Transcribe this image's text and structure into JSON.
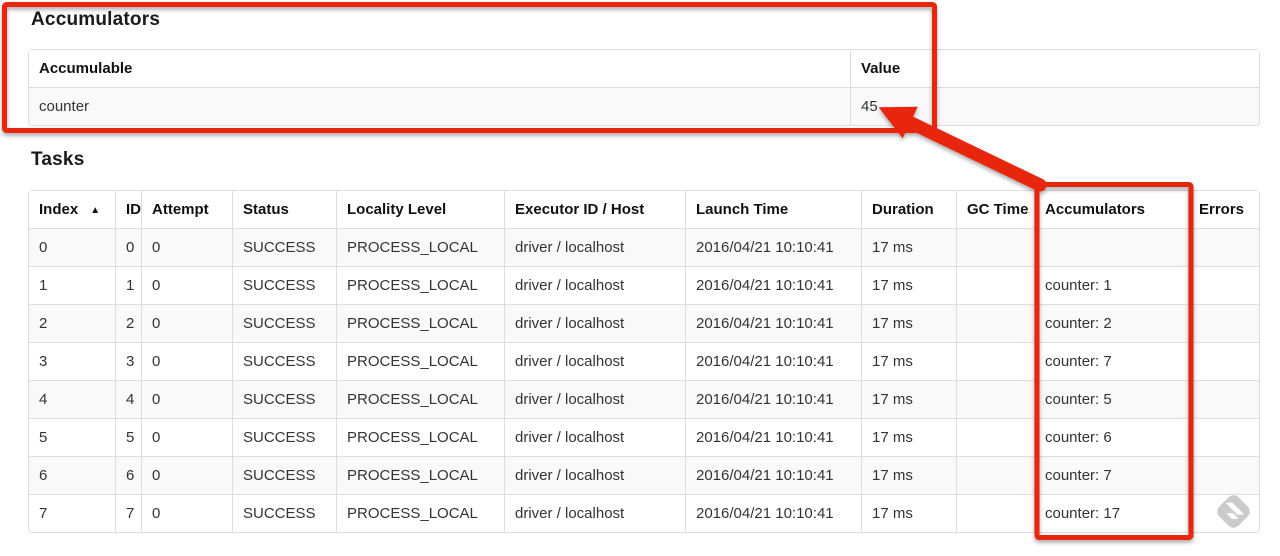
{
  "accumulators_section": {
    "heading": "Accumulators",
    "table": {
      "headers": [
        "Accumulable",
        "Value"
      ],
      "rows": [
        {
          "accumulable": "counter",
          "value": "45"
        }
      ]
    }
  },
  "tasks_section": {
    "heading": "Tasks",
    "table": {
      "headers": {
        "index": "Index",
        "id": "ID",
        "attempt": "Attempt",
        "status": "Status",
        "locality_level": "Locality Level",
        "executor_id_host": "Executor ID / Host",
        "launch_time": "Launch Time",
        "duration": "Duration",
        "gc_time": "GC Time",
        "accumulators": "Accumulators",
        "errors": "Errors"
      },
      "sort_ascending_icon": "▲",
      "rows": [
        {
          "index": "0",
          "id": "0",
          "attempt": "0",
          "status": "SUCCESS",
          "locality_level": "PROCESS_LOCAL",
          "executor_id_host": "driver / localhost",
          "launch_time": "2016/04/21 10:10:41",
          "duration": "17 ms",
          "gc_time": "",
          "accumulators": "",
          "errors": ""
        },
        {
          "index": "1",
          "id": "1",
          "attempt": "0",
          "status": "SUCCESS",
          "locality_level": "PROCESS_LOCAL",
          "executor_id_host": "driver / localhost",
          "launch_time": "2016/04/21 10:10:41",
          "duration": "17 ms",
          "gc_time": "",
          "accumulators": "counter: 1",
          "errors": ""
        },
        {
          "index": "2",
          "id": "2",
          "attempt": "0",
          "status": "SUCCESS",
          "locality_level": "PROCESS_LOCAL",
          "executor_id_host": "driver / localhost",
          "launch_time": "2016/04/21 10:10:41",
          "duration": "17 ms",
          "gc_time": "",
          "accumulators": "counter: 2",
          "errors": ""
        },
        {
          "index": "3",
          "id": "3",
          "attempt": "0",
          "status": "SUCCESS",
          "locality_level": "PROCESS_LOCAL",
          "executor_id_host": "driver / localhost",
          "launch_time": "2016/04/21 10:10:41",
          "duration": "17 ms",
          "gc_time": "",
          "accumulators": "counter: 7",
          "errors": ""
        },
        {
          "index": "4",
          "id": "4",
          "attempt": "0",
          "status": "SUCCESS",
          "locality_level": "PROCESS_LOCAL",
          "executor_id_host": "driver / localhost",
          "launch_time": "2016/04/21 10:10:41",
          "duration": "17 ms",
          "gc_time": "",
          "accumulators": "counter: 5",
          "errors": ""
        },
        {
          "index": "5",
          "id": "5",
          "attempt": "0",
          "status": "SUCCESS",
          "locality_level": "PROCESS_LOCAL",
          "executor_id_host": "driver / localhost",
          "launch_time": "2016/04/21 10:10:41",
          "duration": "17 ms",
          "gc_time": "",
          "accumulators": "counter: 6",
          "errors": ""
        },
        {
          "index": "6",
          "id": "6",
          "attempt": "0",
          "status": "SUCCESS",
          "locality_level": "PROCESS_LOCAL",
          "executor_id_host": "driver / localhost",
          "launch_time": "2016/04/21 10:10:41",
          "duration": "17 ms",
          "gc_time": "",
          "accumulators": "counter: 7",
          "errors": ""
        },
        {
          "index": "7",
          "id": "7",
          "attempt": "0",
          "status": "SUCCESS",
          "locality_level": "PROCESS_LOCAL",
          "executor_id_host": "driver / localhost",
          "launch_time": "2016/04/21 10:10:41",
          "duration": "17 ms",
          "gc_time": "",
          "accumulators": "counter: 17",
          "errors": ""
        }
      ]
    }
  },
  "annotations": {
    "highlight_color": "#e8260e"
  }
}
